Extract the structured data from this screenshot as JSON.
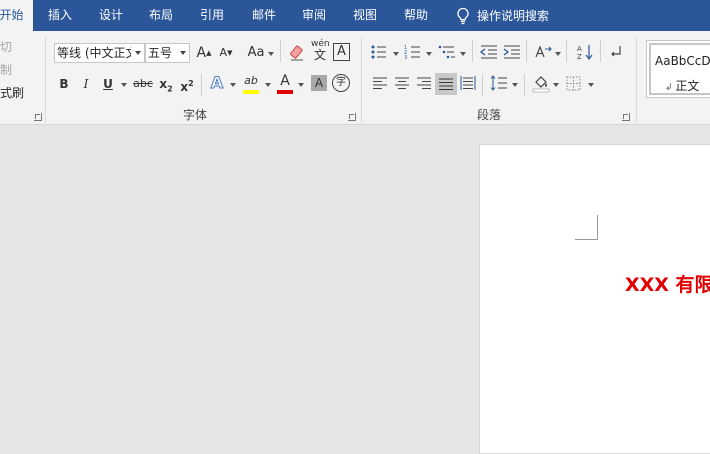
{
  "tabs": [
    {
      "label": "开始",
      "active": true
    },
    {
      "label": "插入"
    },
    {
      "label": "设计"
    },
    {
      "label": "布局"
    },
    {
      "label": "引用"
    },
    {
      "label": "邮件"
    },
    {
      "label": "审阅"
    },
    {
      "label": "视图"
    },
    {
      "label": "帮助"
    }
  ],
  "tell_me": "操作说明搜索",
  "clipboard": {
    "cut": "剪切",
    "copy": "复制",
    "format_painter": "格式刷"
  },
  "font_group": {
    "label": "字体",
    "font_name": "等线 (中文正文)",
    "font_size": "五号",
    "grow_icon": "A",
    "shrink_icon": "A",
    "change_case": "Aa",
    "phonetic": "wén",
    "phonetic_char": "文",
    "char_border": "A",
    "bold": "B",
    "italic": "I",
    "underline": "U",
    "strike": "abc",
    "subscript": "x",
    "superscript": "x",
    "sub_mark": "2",
    "sup_mark": "2",
    "text_effects": "A",
    "highlight": "ab",
    "font_color": "A",
    "char_shading": "A",
    "enclose": "字"
  },
  "paragraph_group": {
    "label": "段落"
  },
  "styles": {
    "sample": "AaBbCcDd",
    "name": "正文"
  },
  "document": {
    "heading": "XXX 有限"
  },
  "colors": {
    "brand": "#2b579a",
    "font_color_bar": "#e00000",
    "highlight_bar": "#ffff00",
    "heading": "#e00000"
  }
}
